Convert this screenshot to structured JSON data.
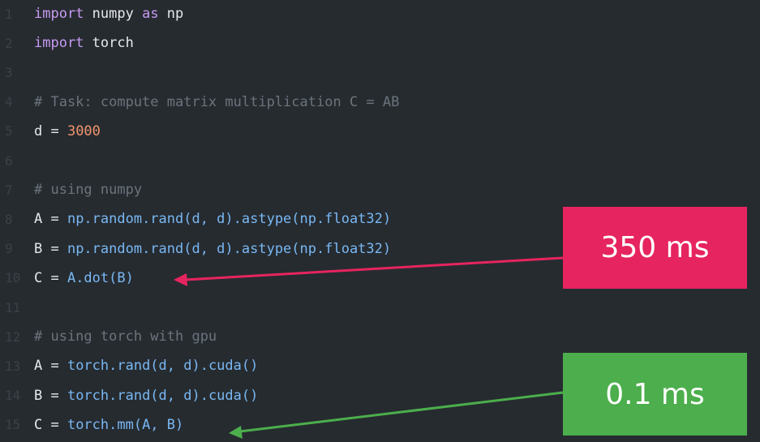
{
  "editor": {
    "lines": [
      {
        "n": "1",
        "tokens": [
          {
            "t": "import",
            "c": "kw"
          },
          {
            "t": " numpy ",
            "c": "plain"
          },
          {
            "t": "as",
            "c": "kw"
          },
          {
            "t": " np",
            "c": "plain"
          }
        ]
      },
      {
        "n": "2",
        "tokens": [
          {
            "t": "import",
            "c": "kw"
          },
          {
            "t": " torch",
            "c": "plain"
          }
        ]
      },
      {
        "n": "3",
        "tokens": []
      },
      {
        "n": "4",
        "tokens": [
          {
            "t": "# Task: compute matrix multiplication C = AB",
            "c": "cm"
          }
        ]
      },
      {
        "n": "5",
        "tokens": [
          {
            "t": "d = ",
            "c": "plain"
          },
          {
            "t": "3000",
            "c": "num"
          }
        ]
      },
      {
        "n": "6",
        "tokens": []
      },
      {
        "n": "7",
        "tokens": [
          {
            "t": "# using numpy",
            "c": "cm"
          }
        ]
      },
      {
        "n": "8",
        "tokens": [
          {
            "t": "A = ",
            "c": "plain"
          },
          {
            "t": "np.random.rand(d, d).astype(np.float32)",
            "c": "fn"
          }
        ]
      },
      {
        "n": "9",
        "tokens": [
          {
            "t": "B = ",
            "c": "plain"
          },
          {
            "t": "np.random.rand(d, d).astype(np.float32)",
            "c": "fn"
          }
        ]
      },
      {
        "n": "10",
        "tokens": [
          {
            "t": "C = ",
            "c": "plain"
          },
          {
            "t": "A.dot(B)",
            "c": "fn"
          }
        ]
      },
      {
        "n": "11",
        "tokens": []
      },
      {
        "n": "12",
        "tokens": [
          {
            "t": "# using torch with gpu",
            "c": "cm"
          }
        ]
      },
      {
        "n": "13",
        "tokens": [
          {
            "t": "A = ",
            "c": "plain"
          },
          {
            "t": "torch.rand(d, d).cuda()",
            "c": "fn"
          }
        ]
      },
      {
        "n": "14",
        "tokens": [
          {
            "t": "B = ",
            "c": "plain"
          },
          {
            "t": "torch.rand(d, d).cuda()",
            "c": "fn"
          }
        ]
      },
      {
        "n": "15",
        "tokens": [
          {
            "t": "C = ",
            "c": "plain"
          },
          {
            "t": "torch.mm(A, B)",
            "c": "fn"
          }
        ]
      }
    ]
  },
  "annotations": {
    "numpy_time": "350 ms",
    "torch_time": "0.1 ms",
    "numpy_color": "#e6245f",
    "torch_color": "#4cae4c"
  }
}
